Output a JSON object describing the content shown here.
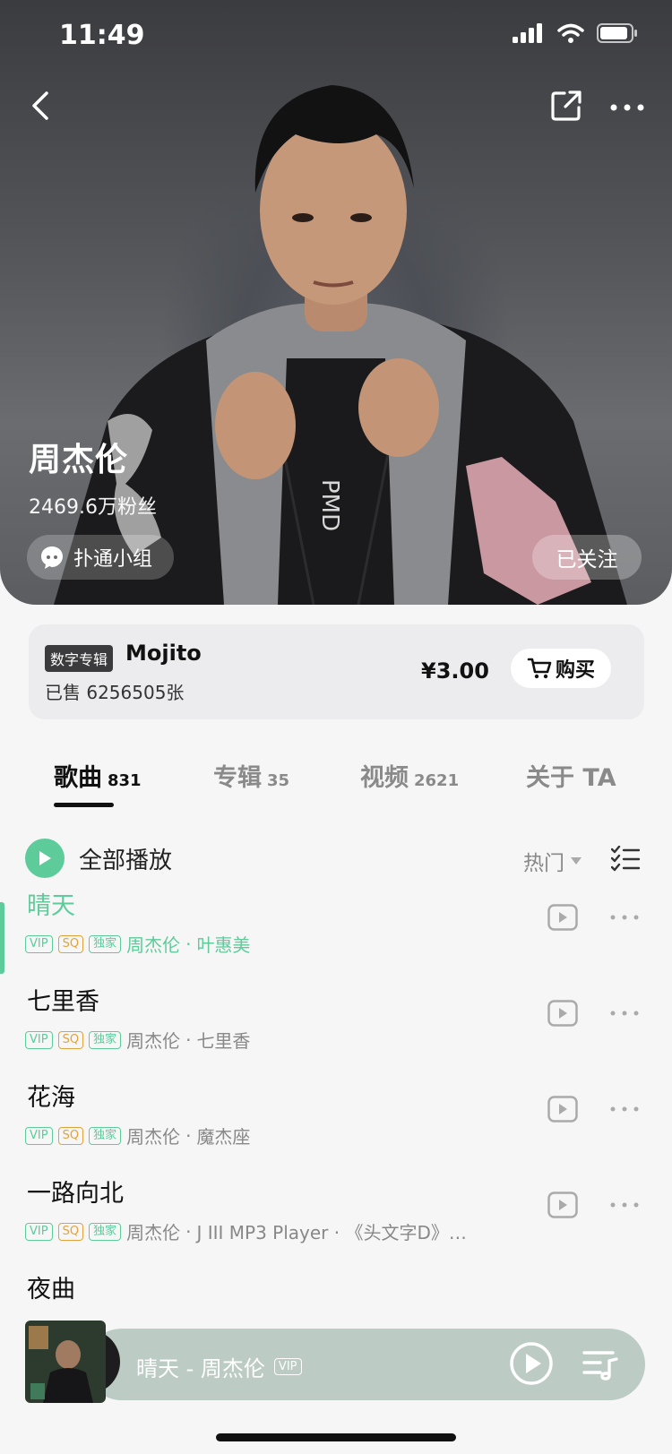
{
  "status_bar": {
    "time": "11:49"
  },
  "artist": {
    "name": "周杰伦",
    "fans": "2469.6万粉丝",
    "group_label": "扑通小组",
    "follow_label": "已关注"
  },
  "album": {
    "tag": "数字专辑",
    "name": "Mojito",
    "sold": "已售 6256505张",
    "price": "¥3.00",
    "buy_label": "购买"
  },
  "tabs": [
    {
      "label": "歌曲",
      "count": "831",
      "active": true
    },
    {
      "label": "专辑",
      "count": "35",
      "active": false
    },
    {
      "label": "视频",
      "count": "2621",
      "active": false
    },
    {
      "label": "关于 TA",
      "count": "",
      "active": false
    }
  ],
  "play_all": {
    "label": "全部播放",
    "sort": "热门"
  },
  "badges": {
    "vip": "VIP",
    "sq": "SQ",
    "ex": "独家"
  },
  "songs": [
    {
      "title": "晴天",
      "artist": "周杰伦",
      "album": "叶惠美",
      "active": true
    },
    {
      "title": "七里香",
      "artist": "周杰伦",
      "album": "七里香",
      "active": false
    },
    {
      "title": "花海",
      "artist": "周杰伦",
      "album": "魔杰座",
      "active": false
    },
    {
      "title": "一路向北",
      "artist": "周杰伦",
      "album": "J III MP3 Player · 《头文字D》…",
      "active": false
    },
    {
      "title": "夜曲",
      "artist": "",
      "album": "",
      "active": false
    }
  ],
  "mini_player": {
    "title": "晴天 - 周杰伦",
    "badge": "VIP"
  },
  "colors": {
    "accent": "#5dcb9a",
    "sq": "#e0a33c"
  }
}
